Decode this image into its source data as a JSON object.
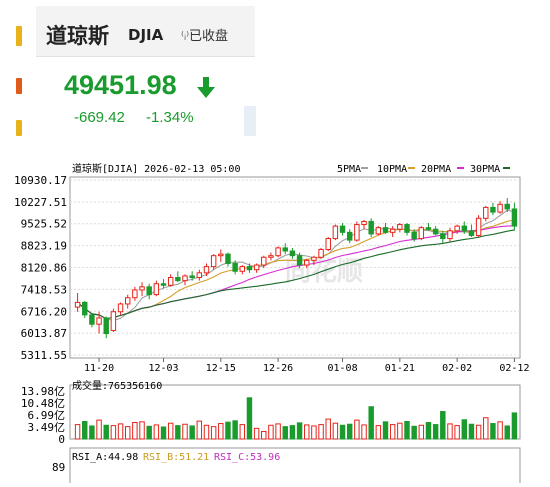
{
  "quote": {
    "name": "道琼斯",
    "code": "DJIA",
    "status": "已收盘",
    "price": "49451.98",
    "change": "-669.42",
    "change_pct": "-1.34%"
  },
  "colors": {
    "up": "#e8231a",
    "down": "#1a9b2d",
    "ma5": "#a0a0a0",
    "ma10": "#d4a02a",
    "ma20": "#d72cd4",
    "ma30": "#1a6b2a"
  },
  "chart_header": {
    "title": "道琼斯[DJIA] 2026-02-13 05:00",
    "ma5": "5PMA",
    "ma10": "10PMA",
    "ma20": "20PMA",
    "ma30": "30PMA"
  },
  "watermark": "同花顺",
  "volume_header": {
    "label": "成交量:",
    "value": "765356160"
  },
  "rsi_header": {
    "a": "RSI_A:44.98",
    "b": "RSI_B:51.21",
    "c": "RSI_C:53.96",
    "top_tick": "89"
  },
  "chart_data": {
    "type": "candlestick",
    "price_axis": {
      "ticks": [
        "10930.17",
        "10227.51",
        "9525.52",
        "8823.19",
        "8120.86",
        "7418.53",
        "6716.20",
        "6013.87",
        "5311.55"
      ],
      "tick_values": [
        10930.17,
        10227.51,
        9525.52,
        8823.19,
        8120.86,
        7418.53,
        6716.2,
        6013.87,
        5311.55
      ],
      "range": [
        5311.55,
        10930.17
      ]
    },
    "x_ticks": [
      {
        "label": "11-20",
        "index": 3
      },
      {
        "label": "12-03",
        "index": 12
      },
      {
        "label": "12-15",
        "index": 20
      },
      {
        "label": "12-26",
        "index": 28
      },
      {
        "label": "01-08",
        "index": 37
      },
      {
        "label": "01-21",
        "index": 45
      },
      {
        "label": "02-02",
        "index": 53
      },
      {
        "label": "02-12",
        "index": 61
      }
    ],
    "candles": [
      [
        6850,
        7300,
        6700,
        7000
      ],
      [
        7000,
        7050,
        6500,
        6600
      ],
      [
        6600,
        6650,
        6200,
        6300
      ],
      [
        6300,
        6700,
        6000,
        6500
      ],
      [
        6500,
        6550,
        5850,
        6000
      ],
      [
        6100,
        6800,
        6050,
        6700
      ],
      [
        6700,
        7000,
        6600,
        6950
      ],
      [
        6950,
        7250,
        6800,
        7150
      ],
      [
        7150,
        7500,
        7050,
        7400
      ],
      [
        7400,
        7650,
        7200,
        7500
      ],
      [
        7500,
        7600,
        7100,
        7250
      ],
      [
        7250,
        7700,
        7200,
        7600
      ],
      [
        7600,
        7750,
        7450,
        7550
      ],
      [
        7550,
        7900,
        7500,
        7800
      ],
      [
        7800,
        8000,
        7650,
        7700
      ],
      [
        7700,
        7900,
        7550,
        7850
      ],
      [
        7850,
        8000,
        7700,
        7800
      ],
      [
        7800,
        8050,
        7700,
        7950
      ],
      [
        7950,
        8250,
        7850,
        8150
      ],
      [
        8150,
        8550,
        8050,
        8500
      ],
      [
        8500,
        8700,
        8300,
        8550
      ],
      [
        8550,
        8600,
        8150,
        8250
      ],
      [
        8250,
        8350,
        7900,
        8000
      ],
      [
        8000,
        8200,
        7900,
        8150
      ],
      [
        8150,
        8250,
        7950,
        8050
      ],
      [
        8050,
        8250,
        7950,
        8200
      ],
      [
        8200,
        8500,
        8100,
        8450
      ],
      [
        8450,
        8600,
        8350,
        8500
      ],
      [
        8500,
        8800,
        8450,
        8750
      ],
      [
        8750,
        8900,
        8550,
        8650
      ],
      [
        8650,
        8750,
        8400,
        8500
      ],
      [
        8500,
        8600,
        8100,
        8200
      ],
      [
        8200,
        8400,
        8100,
        8350
      ],
      [
        8350,
        8500,
        8200,
        8450
      ],
      [
        8450,
        8750,
        8400,
        8700
      ],
      [
        8700,
        9100,
        8650,
        9050
      ],
      [
        9050,
        9500,
        9000,
        9450
      ],
      [
        9450,
        9550,
        9150,
        9250
      ],
      [
        9250,
        9350,
        8900,
        9000
      ],
      [
        9000,
        9600,
        8950,
        9500
      ],
      [
        9500,
        9650,
        9350,
        9600
      ],
      [
        9600,
        9700,
        9100,
        9200
      ],
      [
        9200,
        9450,
        9150,
        9400
      ],
      [
        9400,
        9550,
        9200,
        9250
      ],
      [
        9250,
        9450,
        9100,
        9350
      ],
      [
        9350,
        9550,
        9250,
        9500
      ],
      [
        9500,
        9550,
        9150,
        9250
      ],
      [
        9250,
        9350,
        8950,
        9050
      ],
      [
        9050,
        9450,
        9000,
        9400
      ],
      [
        9400,
        9550,
        9300,
        9350
      ],
      [
        9350,
        9450,
        9150,
        9200
      ],
      [
        9200,
        9300,
        8900,
        9050
      ],
      [
        9050,
        9400,
        8950,
        9300
      ],
      [
        9300,
        9500,
        9200,
        9450
      ],
      [
        9450,
        9600,
        9200,
        9300
      ],
      [
        9300,
        9500,
        9100,
        9150
      ],
      [
        9150,
        9800,
        9100,
        9700
      ],
      [
        9700,
        10100,
        9600,
        10050
      ],
      [
        10050,
        10200,
        9800,
        9900
      ],
      [
        9900,
        10250,
        9850,
        10150
      ],
      [
        10150,
        10350,
        9900,
        10000
      ],
      [
        10000,
        10200,
        9300,
        9450
      ]
    ],
    "volume_axis": {
      "ticks": [
        "13.98亿",
        "10.48亿",
        "6.99亿",
        "3.49亿",
        "0"
      ],
      "tick_values": [
        13.98,
        10.48,
        6.99,
        3.49,
        0
      ],
      "unit": "亿"
    },
    "volumes": [
      4.2,
      5.1,
      3.8,
      5.5,
      4.0,
      3.9,
      4.4,
      3.6,
      4.8,
      5.0,
      3.7,
      4.1,
      3.5,
      4.6,
      3.9,
      4.3,
      3.8,
      5.2,
      4.0,
      3.6,
      4.5,
      4.9,
      5.3,
      4.2,
      12.0,
      3.1,
      2.2,
      4.0,
      4.4,
      3.6,
      3.9,
      4.7,
      4.1,
      3.8,
      4.2,
      5.8,
      4.6,
      4.0,
      4.3,
      5.5,
      4.1,
      9.4,
      3.9,
      5.0,
      4.2,
      4.6,
      5.1,
      3.7,
      4.0,
      4.8,
      4.2,
      8.0,
      4.4,
      3.9,
      5.6,
      4.3,
      4.0,
      6.2,
      4.5,
      5.0,
      3.8,
      7.6
    ]
  }
}
